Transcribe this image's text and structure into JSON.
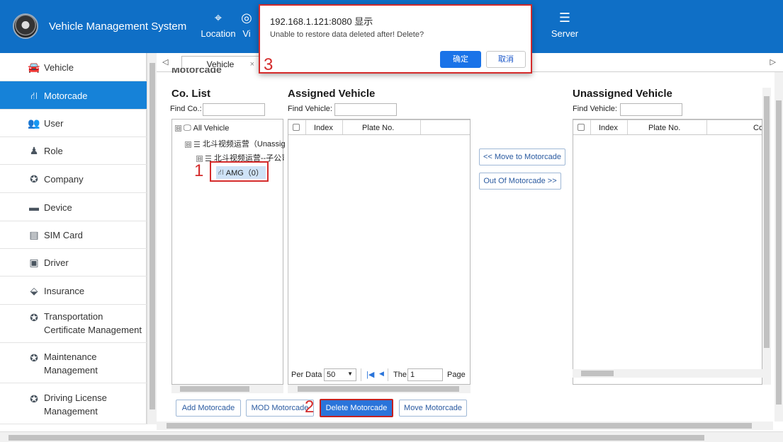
{
  "header": {
    "app_title": "Vehicle Management System",
    "nav": [
      {
        "label": "Location",
        "icon": "location-pin-icon"
      },
      {
        "label": "Vi",
        "icon": "video-icon"
      },
      {
        "label": "Server",
        "icon": "server-icon"
      }
    ],
    "colors": {
      "bar": "#0f6fc6",
      "active": "#1682d8",
      "annotation": "#d42b2b"
    }
  },
  "sidebar": {
    "items": [
      {
        "label": "Vehicle",
        "icon": "car-icon"
      },
      {
        "label": "Motorcade",
        "icon": "motorcade-icon",
        "active": true
      },
      {
        "label": "User",
        "icon": "users-icon"
      },
      {
        "label": "Role",
        "icon": "role-icon"
      },
      {
        "label": "Company",
        "icon": "company-icon"
      },
      {
        "label": "Device",
        "icon": "device-icon"
      },
      {
        "label": "SIM Card",
        "icon": "sim-card-icon"
      },
      {
        "label": "Driver",
        "icon": "driver-card-icon"
      },
      {
        "label": "Insurance",
        "icon": "insurance-icon"
      },
      {
        "label": "Transportation",
        "label2": "Certificate Management",
        "icon": "certificate-icon"
      },
      {
        "label": "Maintenance",
        "label2": "Management",
        "icon": "maintenance-icon"
      },
      {
        "label": "Driving License",
        "label2": "Management",
        "icon": "license-icon"
      }
    ]
  },
  "tabs": {
    "active": "Vehicle",
    "close": "×",
    "prev": "◁",
    "next": "▷"
  },
  "page": {
    "title": "Motorcade"
  },
  "co_list": {
    "title": "Co. List",
    "find_label": "Find Co.:",
    "find_value": "",
    "tree": [
      {
        "label": "All Vehicle",
        "toggle": "⊟"
      },
      {
        "label": "北斗视频运营（Unassig",
        "toggle": "⊟"
      },
      {
        "label": "北斗视频运营--子公司",
        "toggle": "⊟"
      },
      {
        "label": "AMG（0）"
      }
    ]
  },
  "assigned": {
    "title": "Assigned Vehicle",
    "find_label": "Find Vehicle:",
    "find_value": "",
    "columns": [
      "Index",
      "Plate No."
    ],
    "pager": {
      "per_label": "Per Data",
      "per_value": "50",
      "the_label": "The",
      "page_value": "1",
      "page_label": "Page"
    }
  },
  "unassigned": {
    "title": "Unassigned Vehicle",
    "find_label": "Find Vehicle:",
    "find_value": "",
    "columns": [
      "Index",
      "Plate No.",
      "Co"
    ]
  },
  "move_buttons": {
    "to": "<< Move to Motorcade",
    "out": "Out Of Motorcade >>"
  },
  "actions": {
    "add": "Add Motorcade",
    "mod": "MOD Motorcade",
    "delete": "Delete Motorcade",
    "move": "Move Motorcade"
  },
  "annotations": [
    "1",
    "2",
    "3"
  ],
  "dialog": {
    "origin": "192.168.1.121:8080 显示",
    "message": "Unable to restore data deleted after! Delete?",
    "ok": "确定",
    "cancel": "取消"
  }
}
